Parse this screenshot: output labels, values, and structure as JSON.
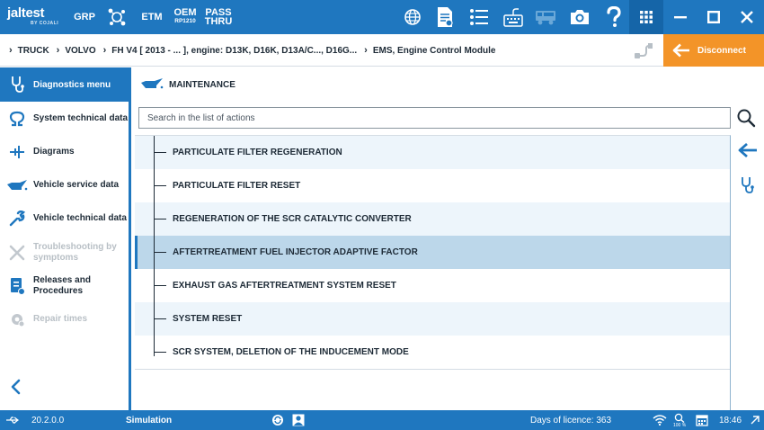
{
  "topbar": {
    "logo": "jaltest",
    "logo_sub": "BY COJALI",
    "nav": {
      "grp": "GRP",
      "etm": "ETM",
      "oem_l1": "OEM",
      "oem_l2": "RP1210",
      "pass_l1": "PASS",
      "pass_l2": "THRU"
    },
    "icons": [
      "network-icon",
      "molecule-icon",
      "globe-icon",
      "report-icon",
      "list-icon",
      "keyboard-icon",
      "truck-icon",
      "camera-icon",
      "help-icon",
      "apps-grid-icon",
      "minimize-icon",
      "maximize-icon",
      "close-icon"
    ]
  },
  "breadcrumb": {
    "items": [
      "TRUCK",
      "VOLVO",
      "FH V4 [ 2013 - ... ], engine: D13K, D16K, D13A/C..., D16G...",
      "EMS, Engine Control Module"
    ]
  },
  "disconnect": {
    "label": "Disconnect"
  },
  "sidebar": {
    "header": "Diagnostics menu",
    "items": [
      {
        "label": "System technical data",
        "icon": "omega-icon",
        "enabled": true
      },
      {
        "label": "Diagrams",
        "icon": "diagram-icon",
        "enabled": true
      },
      {
        "label": "Vehicle service data",
        "icon": "oil-can-icon",
        "enabled": true
      },
      {
        "label": "Vehicle technical data",
        "icon": "wrench-icon",
        "enabled": true
      },
      {
        "label": "Troubleshooting by symptoms",
        "icon": "tools-icon",
        "enabled": false
      },
      {
        "label": "Releases and Procedures",
        "icon": "procedures-icon",
        "enabled": true
      },
      {
        "label": "Repair times",
        "icon": "gear-clock-icon",
        "enabled": false
      }
    ]
  },
  "main": {
    "section_title": "MAINTENANCE",
    "search_placeholder": "Search in the list of actions",
    "actions": [
      {
        "label": "PARTICULATE FILTER REGENERATION",
        "selected": false
      },
      {
        "label": "PARTICULATE FILTER RESET",
        "selected": false
      },
      {
        "label": "REGENERATION OF THE SCR CATALYTIC CONVERTER",
        "selected": false
      },
      {
        "label": "AFTERTREATMENT FUEL INJECTOR ADAPTIVE FACTOR",
        "selected": true
      },
      {
        "label": "EXHAUST GAS AFTERTREATMENT SYSTEM RESET",
        "selected": false
      },
      {
        "label": "SYSTEM RESET",
        "selected": false
      },
      {
        "label": "SCR SYSTEM, DELETION OF THE INDUCEMENT MODE",
        "selected": false
      }
    ]
  },
  "status": {
    "version": "20.2.0.0",
    "mode": "Simulation",
    "licence": "Days of licence: 363",
    "zoom": "100 %",
    "time": "18:46"
  },
  "colors": {
    "accent": "#1f77bf",
    "disconnect": "#f39428",
    "selected_row": "#bcd7ea",
    "alt_row": "#edf5fb"
  }
}
